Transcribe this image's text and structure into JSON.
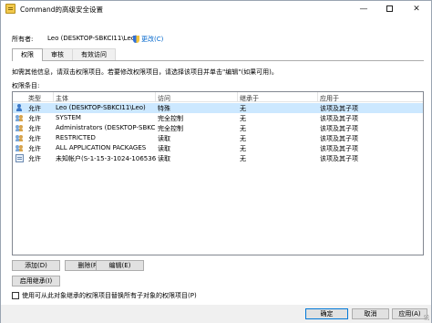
{
  "window": {
    "title": "Command的高级安全设置",
    "min_glyph": "—",
    "close_glyph": "✕"
  },
  "owner": {
    "label": "所有者:",
    "value": "Leo (DESKTOP-SBKCI11\\Leo)",
    "change_label": "更改(C)"
  },
  "tabs": [
    {
      "label": "权限",
      "active": true
    },
    {
      "label": "审核",
      "active": false
    },
    {
      "label": "有效访问",
      "active": false
    }
  ],
  "info_text": "如需其他信息，请双击权限项目。若要修改权限项目，请选择该项目并单击\"编辑\"(如果可用)。",
  "entries_label": "权限条目:",
  "table": {
    "headers": [
      "类型",
      "主体",
      "访问",
      "继承于",
      "应用于"
    ],
    "rows": [
      {
        "icon": "user-icon",
        "type": "允许",
        "principal": "Leo (DESKTOP-SBKCI11\\Leo)",
        "access": "特殊",
        "inherited": "无",
        "applies": "该项及其子项",
        "selected": true
      },
      {
        "icon": "group-icon",
        "type": "允许",
        "principal": "SYSTEM",
        "access": "完全控制",
        "inherited": "无",
        "applies": "该项及其子项",
        "selected": false
      },
      {
        "icon": "group-icon",
        "type": "允许",
        "principal": "Administrators (DESKTOP-SBKCI11\\...",
        "access": "完全控制",
        "inherited": "无",
        "applies": "该项及其子项",
        "selected": false
      },
      {
        "icon": "group-icon",
        "type": "允许",
        "principal": "RESTRICTED",
        "access": "读取",
        "inherited": "无",
        "applies": "该项及其子项",
        "selected": false
      },
      {
        "icon": "group-icon",
        "type": "允许",
        "principal": "ALL APPLICATION PACKAGES",
        "access": "读取",
        "inherited": "无",
        "applies": "该项及其子项",
        "selected": false
      },
      {
        "icon": "unknown-account-icon",
        "type": "允许",
        "principal": "未知帐户(S-1-15-3-1024-1065365...",
        "access": "读取",
        "inherited": "无",
        "applies": "该项及其子项",
        "selected": false
      }
    ]
  },
  "buttons": {
    "add": "添加(D)",
    "remove": "删除(R)",
    "edit": "编辑(E)",
    "enable_inheritance": "启用继承(I)",
    "ok": "确定",
    "cancel": "取消",
    "apply": "应用(A)"
  },
  "replace_checkbox_label": "使用可从此对象继承的权限项目替换所有子对象的权限项目(P)"
}
